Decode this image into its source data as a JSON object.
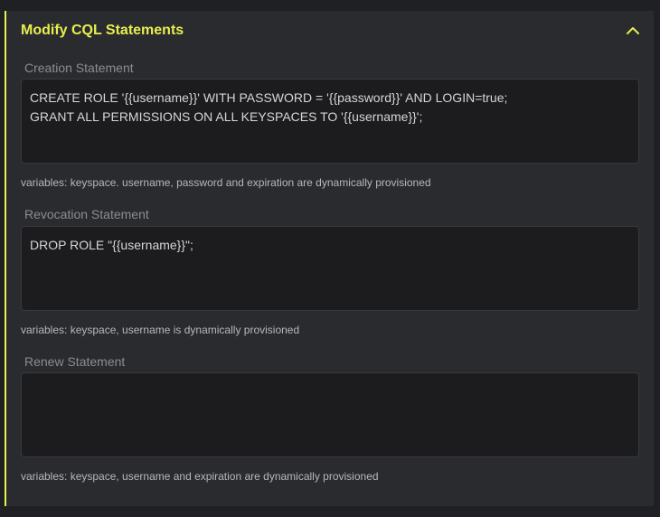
{
  "section": {
    "title": "Modify CQL Statements"
  },
  "creation": {
    "label": "Creation Statement",
    "value": "CREATE ROLE '{{username}}' WITH PASSWORD = '{{password}}' AND LOGIN=true;\nGRANT ALL PERMISSIONS ON ALL KEYSPACES TO '{{username}}';",
    "help": "variables: keyspace. username, password and expiration are dynamically provisioned"
  },
  "revocation": {
    "label": "Revocation Statement",
    "value": "DROP ROLE \"{{username}}\";",
    "help": "variables: keyspace, username is dynamically provisioned"
  },
  "renew": {
    "label": "Renew Statement",
    "value": "",
    "help": "variables: keyspace, username and expiration are dynamically provisioned"
  },
  "colors": {
    "accent": "#e6ef4f",
    "panel_bg": "#2a2b2e",
    "field_bg": "#1c1c1f"
  },
  "icons": {
    "collapse": "chevron-up-icon"
  }
}
